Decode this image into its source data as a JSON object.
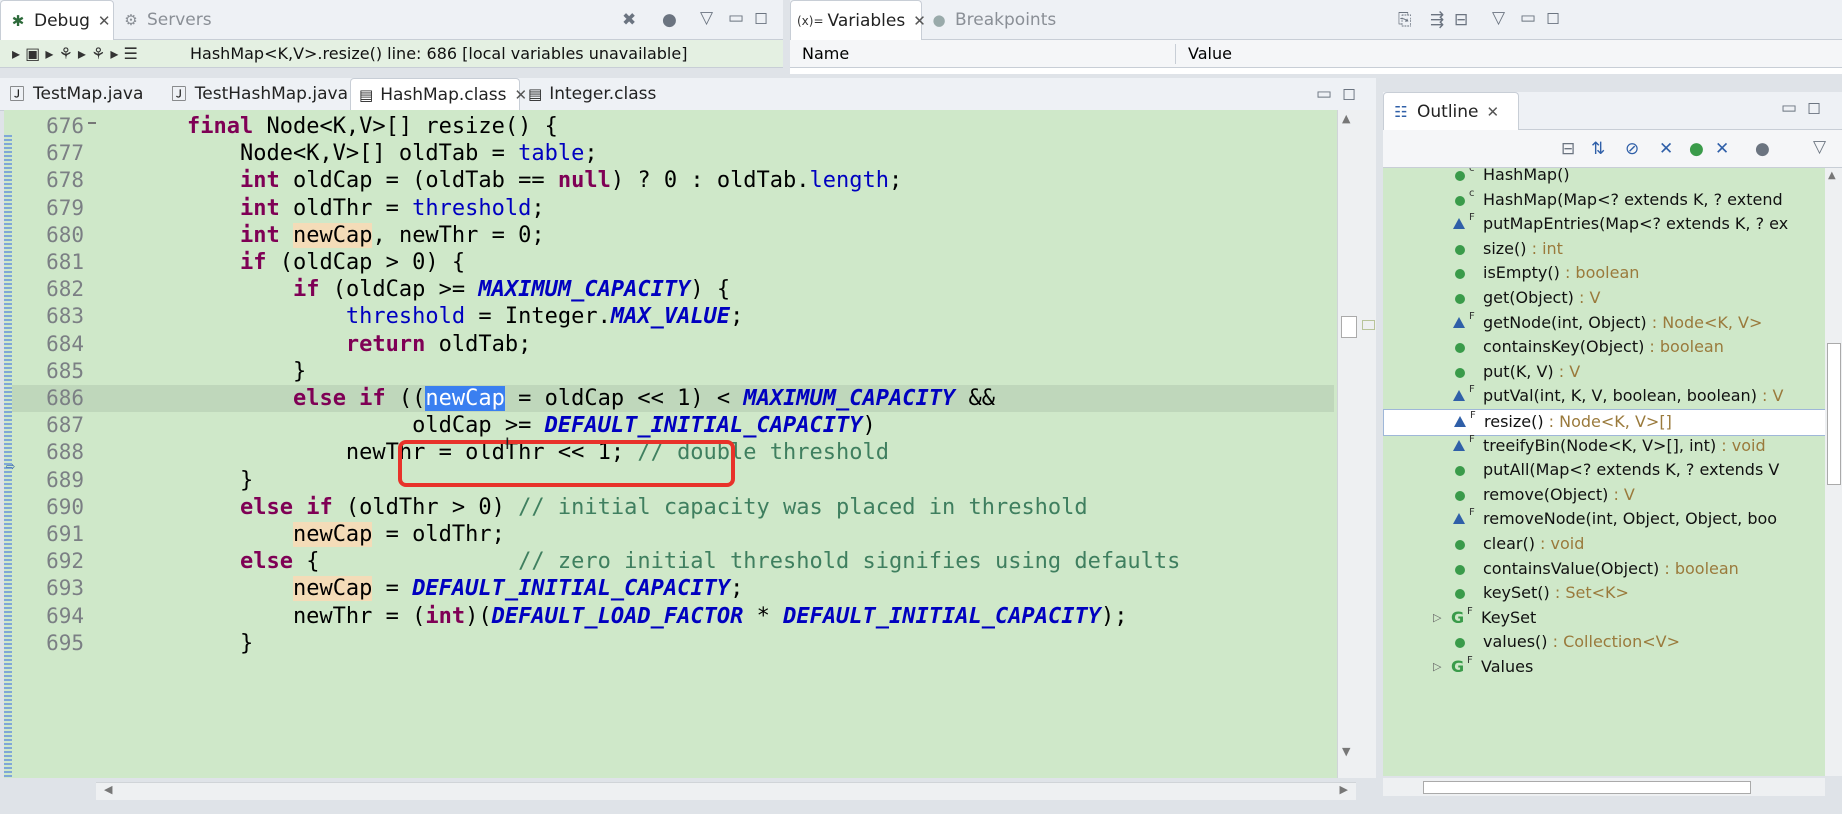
{
  "debug_panel": {
    "tabs": [
      {
        "label": "Debug",
        "active": true
      },
      {
        "label": "Servers",
        "active": false
      }
    ],
    "stack_line": "HashMap<K,V>.resize() line: 686 [local variables unavailable]"
  },
  "variables_panel": {
    "tabs": [
      {
        "label": "Variables",
        "prefix": "(x)=",
        "active": true
      },
      {
        "label": "Breakpoints",
        "active": false
      }
    ],
    "columns": [
      "Name",
      "Value"
    ]
  },
  "editor": {
    "tabs": [
      {
        "label": "TestMap.java",
        "active": false
      },
      {
        "label": "TestHashMap.java",
        "active": false
      },
      {
        "label": "HashMap.class",
        "active": true
      },
      {
        "label": "Integer.class",
        "active": false
      }
    ],
    "current_line": 686,
    "lines": [
      {
        "n": "676",
        "parts": [
          [
            "",
            "    "
          ],
          [
            "kw",
            "final"
          ],
          [
            "",
            " Node<K,V>[] resize() {"
          ]
        ]
      },
      {
        "n": "677",
        "parts": [
          [
            "",
            "        Node<K,V>[] oldTab = "
          ],
          [
            "fld",
            "table"
          ],
          [
            "",
            ";"
          ]
        ]
      },
      {
        "n": "678",
        "parts": [
          [
            "",
            "        "
          ],
          [
            "kw",
            "int"
          ],
          [
            "",
            " oldCap = (oldTab == "
          ],
          [
            "kw",
            "null"
          ],
          [
            "",
            ") ? 0 : oldTab."
          ],
          [
            "fld",
            "length"
          ],
          [
            "",
            ";"
          ]
        ]
      },
      {
        "n": "679",
        "parts": [
          [
            "",
            "        "
          ],
          [
            "kw",
            "int"
          ],
          [
            "",
            " oldThr = "
          ],
          [
            "fld",
            "threshold"
          ],
          [
            "",
            ";"
          ]
        ]
      },
      {
        "n": "680",
        "parts": [
          [
            "",
            "        "
          ],
          [
            "kw",
            "int"
          ],
          [
            "",
            " "
          ],
          [
            "mark",
            "newCap"
          ],
          [
            "",
            ", newThr = 0;"
          ]
        ]
      },
      {
        "n": "681",
        "parts": [
          [
            "",
            "        "
          ],
          [
            "kw",
            "if"
          ],
          [
            "",
            " (oldCap > 0) {"
          ]
        ]
      },
      {
        "n": "682",
        "parts": [
          [
            "",
            "            "
          ],
          [
            "kw",
            "if"
          ],
          [
            "",
            " (oldCap >= "
          ],
          [
            "cst",
            "MAXIMUM_CAPACITY"
          ],
          [
            "",
            ") {"
          ]
        ]
      },
      {
        "n": "683",
        "parts": [
          [
            "",
            "                "
          ],
          [
            "fld",
            "threshold"
          ],
          [
            "",
            " = Integer."
          ],
          [
            "cst",
            "MAX_VALUE"
          ],
          [
            "",
            ";"
          ]
        ]
      },
      {
        "n": "684",
        "parts": [
          [
            "",
            "                "
          ],
          [
            "kw",
            "return"
          ],
          [
            "",
            " oldTab;"
          ]
        ]
      },
      {
        "n": "685",
        "parts": [
          [
            "",
            "            }"
          ]
        ]
      },
      {
        "n": "686",
        "parts": [
          [
            "",
            "            "
          ],
          [
            "kw",
            "else if"
          ],
          [
            "",
            " (("
          ],
          [
            "sel",
            "newCap"
          ],
          [
            "",
            " = oldCap << 1) < "
          ],
          [
            "cst",
            "MAXIMUM_CAPACITY"
          ],
          [
            "",
            " &&"
          ]
        ]
      },
      {
        "n": "687",
        "parts": [
          [
            "",
            "                     oldCap >= "
          ],
          [
            "cst",
            "DEFAULT_INITIAL_CAPACITY"
          ],
          [
            "",
            ")"
          ]
        ]
      },
      {
        "n": "688",
        "parts": [
          [
            "",
            "                newThr = oldThr << 1; "
          ],
          [
            "cmt",
            "// double threshold"
          ]
        ]
      },
      {
        "n": "689",
        "parts": [
          [
            "",
            "        }"
          ]
        ]
      },
      {
        "n": "690",
        "parts": [
          [
            "",
            "        "
          ],
          [
            "kw",
            "else if"
          ],
          [
            "",
            " (oldThr > 0) "
          ],
          [
            "cmt",
            "// initial capacity was placed in threshold"
          ]
        ]
      },
      {
        "n": "691",
        "parts": [
          [
            "",
            "            "
          ],
          [
            "mark",
            "newCap"
          ],
          [
            "",
            " = oldThr;"
          ]
        ]
      },
      {
        "n": "692",
        "parts": [
          [
            "",
            "        "
          ],
          [
            "kw",
            "else"
          ],
          [
            "",
            " {               "
          ],
          [
            "cmt",
            "// zero initial threshold signifies using defaults"
          ]
        ]
      },
      {
        "n": "693",
        "parts": [
          [
            "",
            "            "
          ],
          [
            "mark",
            "newCap"
          ],
          [
            "",
            " = "
          ],
          [
            "cst",
            "DEFAULT_INITIAL_CAPACITY"
          ],
          [
            "",
            ";"
          ]
        ]
      },
      {
        "n": "694",
        "parts": [
          [
            "",
            "            newThr = ("
          ],
          [
            "kw",
            "int"
          ],
          [
            "",
            ")("
          ],
          [
            "cst",
            "DEFAULT_LOAD_FACTOR"
          ],
          [
            "",
            " * "
          ],
          [
            "cst",
            "DEFAULT_INITIAL_CAPACITY"
          ],
          [
            "",
            ");"
          ]
        ]
      },
      {
        "n": "695",
        "parts": [
          [
            "",
            "        }"
          ]
        ]
      }
    ]
  },
  "outline": {
    "title": "Outline",
    "items": [
      {
        "label": "HashMap()",
        "type": "",
        "icon": "dot",
        "mod": "c"
      },
      {
        "label": "HashMap(Map<? extends K, ? extend",
        "type": "",
        "icon": "dot",
        "mod": "c"
      },
      {
        "label": "putMapEntries(Map<? extends K, ? ex",
        "type": "",
        "icon": "tri",
        "mod": "F"
      },
      {
        "label": "size()",
        "type": " : int",
        "icon": "dot",
        "mod": ""
      },
      {
        "label": "isEmpty()",
        "type": " : boolean",
        "icon": "dot",
        "mod": ""
      },
      {
        "label": "get(Object)",
        "type": " : V",
        "icon": "dot",
        "mod": ""
      },
      {
        "label": "getNode(int, Object)",
        "type": " : Node<K, V>",
        "icon": "tri",
        "mod": "F"
      },
      {
        "label": "containsKey(Object)",
        "type": " : boolean",
        "icon": "dot",
        "mod": ""
      },
      {
        "label": "put(K, V)",
        "type": " : V",
        "icon": "dot",
        "mod": ""
      },
      {
        "label": "putVal(int, K, V, boolean, boolean)",
        "type": " : V",
        "icon": "tri",
        "mod": "F"
      },
      {
        "label": "resize()",
        "type": " : Node<K, V>[]",
        "icon": "tri",
        "mod": "F",
        "selected": true
      },
      {
        "label": "treeifyBin(Node<K, V>[], int)",
        "type": " : void",
        "icon": "tri",
        "mod": "F"
      },
      {
        "label": "putAll(Map<? extends K, ? extends V",
        "type": "",
        "icon": "dot",
        "mod": ""
      },
      {
        "label": "remove(Object)",
        "type": " : V",
        "icon": "dot",
        "mod": ""
      },
      {
        "label": "removeNode(int, Object, Object, boo",
        "type": "",
        "icon": "tri",
        "mod": "F"
      },
      {
        "label": "clear()",
        "type": " : void",
        "icon": "dot",
        "mod": ""
      },
      {
        "label": "containsValue(Object)",
        "type": " : boolean",
        "icon": "dot",
        "mod": ""
      },
      {
        "label": "keySet()",
        "type": " : Set<K>",
        "icon": "dot",
        "mod": ""
      },
      {
        "label": "KeySet",
        "type": "",
        "icon": "class",
        "mod": "F",
        "expandable": true
      },
      {
        "label": "values()",
        "type": " : Collection<V>",
        "icon": "dot",
        "mod": ""
      },
      {
        "label": "Values",
        "type": "",
        "icon": "class",
        "mod": "F",
        "expandable": true
      }
    ]
  },
  "colors": {
    "editor_bg": "#cfe8c9",
    "highlight_box": "#e8322a",
    "selection": "#3a7ff0"
  }
}
